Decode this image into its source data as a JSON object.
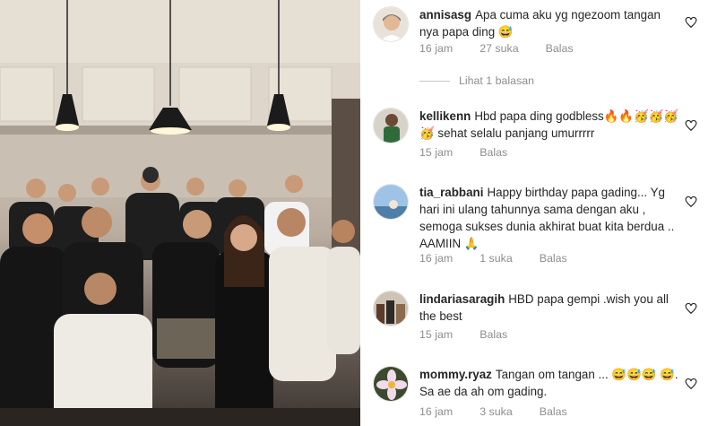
{
  "photo": {
    "alt": ""
  },
  "comments": [
    {
      "username": "annisasg",
      "text": "Apa cuma aku yg ngezoom tangan nya papa ding 😅",
      "time": "16 jam",
      "likes": "27 suka",
      "reply_label": "Balas",
      "avatar_icon": "user-avatar-icon"
    },
    {
      "username": "kellikenn",
      "text": "Hbd papa ding godbless🔥🔥🥳🥳🥳🥳 sehat selalu panjang umurrrrr",
      "time": "15 jam",
      "likes": "",
      "reply_label": "Balas",
      "avatar_icon": "user-avatar-icon"
    },
    {
      "username": "tia_rabbani",
      "text": "Happy birthday papa gading... Yg hari ini ulang tahunnya sama dengan aku , semoga sukses dunia akhirat buat kita berdua .. AAMIIN 🙏",
      "time": "16 jam",
      "likes": "1 suka",
      "reply_label": "Balas",
      "avatar_icon": "user-avatar-icon"
    },
    {
      "username": "lindariasaragih",
      "text": "HBD papa gempi .wish you all the best",
      "time": "15 jam",
      "likes": "",
      "reply_label": "Balas",
      "avatar_icon": "user-avatar-icon"
    },
    {
      "username": "mommy.ryaz",
      "text": "Tangan om tangan ... 😅😅😅 😅. Sa ae da ah om gading.",
      "time": "16 jam",
      "likes": "3 suka",
      "reply_label": "Balas",
      "avatar_icon": "user-avatar-icon"
    }
  ],
  "view_replies_label": "Lihat 1 balasan",
  "colors": {
    "text": "#262626",
    "muted": "#8e8e8e",
    "divider": "#c7c7c7"
  }
}
